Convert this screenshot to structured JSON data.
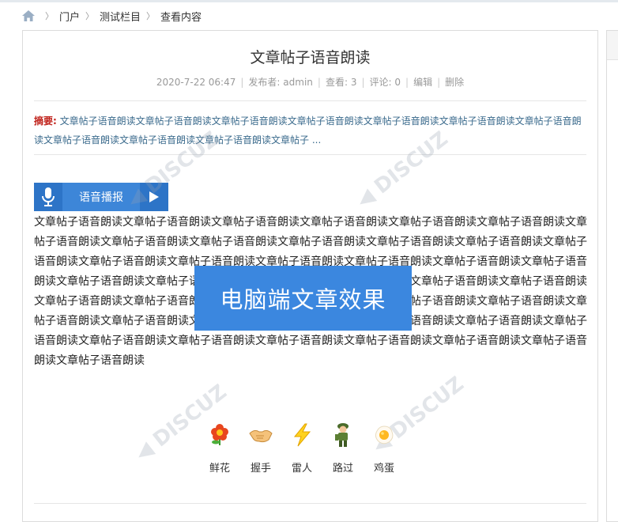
{
  "breadcrumb": {
    "items": [
      "门户",
      "测试栏目",
      "查看内容"
    ]
  },
  "article": {
    "title": "文章帖子语音朗读",
    "date": "2020-7-22 06:47",
    "author_label": "发布者:",
    "author": "admin",
    "views_label": "查看:",
    "views": "3",
    "comments_label": "评论:",
    "comments": "0",
    "edit_label": "编辑",
    "delete_label": "删除",
    "summary_label": "摘要:",
    "summary_text": "文章帖子语音朗读文章帖子语音朗读文章帖子语音朗读文章帖子语音朗读文章帖子语音朗读文章帖子语音朗读文章帖子语音朗读文章帖子语音朗读文章帖子语音朗读文章帖子语音朗读文章帖子 ...",
    "player_label": "语音播报",
    "content": "文章帖子语音朗读文章帖子语音朗读文章帖子语音朗读文章帖子语音朗读文章帖子语音朗读文章帖子语音朗读文章帖子语音朗读文章帖子语音朗读文章帖子语音朗读文章帖子语音朗读文章帖子语音朗读文章帖子语音朗读文章帖子语音朗读文章帖子语音朗读文章帖子语音朗读文章帖子语音朗读文章帖子语音朗读文章帖子语音朗读文章帖子语音朗读文章帖子语音朗读文章帖子语音朗读文章帖子语音朗读文章帖子语音朗读文章帖子语音朗读文章帖子语音朗读文章帖子语音朗读文章帖子语音朗读文章帖子语音朗读文章帖子语音朗读文章帖子语音朗读文章帖子语音朗读文章帖子语音朗读文章帖子语音朗读文章帖子语音朗读文章帖子语音朗读文章帖子语音朗读文章帖子语音朗读文章帖子语音朗读文章帖子语音朗读文章帖子语音朗读文章帖子语音朗读文章帖子语音朗读文章帖子语音朗读文章帖子语音朗读文章帖子语音朗读"
  },
  "banner": {
    "text": "电脑端文章效果"
  },
  "reactions": [
    {
      "label": "鲜花",
      "icon": "flower-icon"
    },
    {
      "label": "握手",
      "icon": "handshake-icon"
    },
    {
      "label": "雷人",
      "icon": "lightning-icon"
    },
    {
      "label": "路过",
      "icon": "soldier-icon"
    },
    {
      "label": "鸡蛋",
      "icon": "egg-icon"
    }
  ],
  "colors": {
    "accent_blue": "#3b87df",
    "summary_label_red": "#c0221b"
  }
}
